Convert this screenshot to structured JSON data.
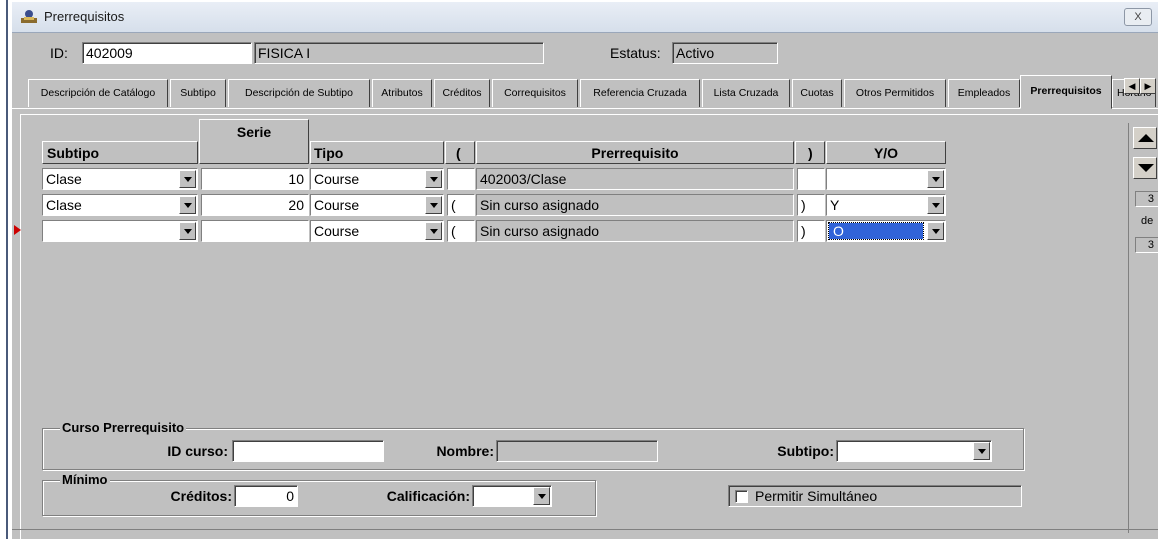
{
  "window": {
    "title": "Prerrequisitos",
    "close_label": "X"
  },
  "header": {
    "id_label": "ID:",
    "id_value": "402009",
    "name_value": "FISICA I",
    "status_label": "Estatus:",
    "status_value": "Activo"
  },
  "tabs": [
    "Descripción de Catálogo",
    "Subtipo",
    "Descripción de Subtipo",
    "Atributos",
    "Créditos",
    "Correquisitos",
    "Referencia Cruzada",
    "Lista Cruzada",
    "Cuotas",
    "Otros Permitidos",
    "Empleados",
    "Prerrequisitos",
    "Horario"
  ],
  "active_tab": "Prerrequisitos",
  "grid": {
    "headers": {
      "subtipo": "Subtipo",
      "serie": "Serie",
      "tipo": "Tipo",
      "open_paren": "(",
      "prerrequisito": "Prerrequisito",
      "close_paren": ")",
      "yo": "Y/O"
    },
    "rows": [
      {
        "subtipo": "Clase",
        "serie": "10",
        "tipo": "Course",
        "open_paren": "",
        "prerrequisito": "402003/Clase",
        "close_paren": "",
        "yo": ""
      },
      {
        "subtipo": "Clase",
        "serie": "20",
        "tipo": "Course",
        "open_paren": "(",
        "prerrequisito": "Sin curso asignado",
        "close_paren": ")",
        "yo": "Y"
      },
      {
        "subtipo": "",
        "serie": "",
        "tipo": "Course",
        "open_paren": "(",
        "prerrequisito": "Sin curso asignado",
        "close_paren": ")",
        "yo": "O"
      }
    ]
  },
  "navigator": {
    "current": "3",
    "of_label": "de",
    "total": "3"
  },
  "curso_prerrequisito": {
    "title": "Curso Prerrequisito",
    "id_curso_label": "ID curso:",
    "id_curso_value": "",
    "nombre_label": "Nombre:",
    "nombre_value": "",
    "subtipo_label": "Subtipo:",
    "subtipo_value": ""
  },
  "minimo": {
    "title": "Mínimo",
    "creditos_label": "Créditos:",
    "creditos_value": "0",
    "calificacion_label": "Calificación:",
    "calificacion_value": ""
  },
  "permitir_simultaneo": {
    "label": "Permitir Simultáneo",
    "checked": false
  }
}
